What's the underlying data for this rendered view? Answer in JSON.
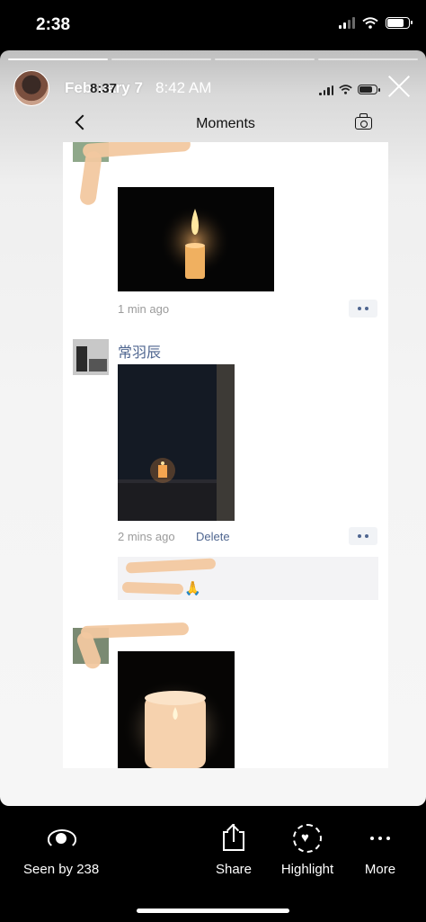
{
  "status_bar": {
    "time": "2:38"
  },
  "story": {
    "user": "February 7",
    "posted": "8:42 AM",
    "progress_segments": 4,
    "progress_done": 1
  },
  "embedded": {
    "status_time": "8:37",
    "nav": {
      "title": "Moments"
    },
    "posts": [
      {
        "name": "",
        "caption": "🕯",
        "image": "lit candle in darkness",
        "time": "1 min ago"
      },
      {
        "name": "常羽辰",
        "image": "small candle on a windowsill at night",
        "time": "2 mins ago",
        "delete_label": "Delete",
        "comment_emoji": "🙏"
      },
      {
        "name": "",
        "image": "candle glowing in a frosted glass jar"
      }
    ]
  },
  "actions": {
    "seen_by": "Seen by 238",
    "share": "Share",
    "highlight": "Highlight",
    "more": "More"
  }
}
